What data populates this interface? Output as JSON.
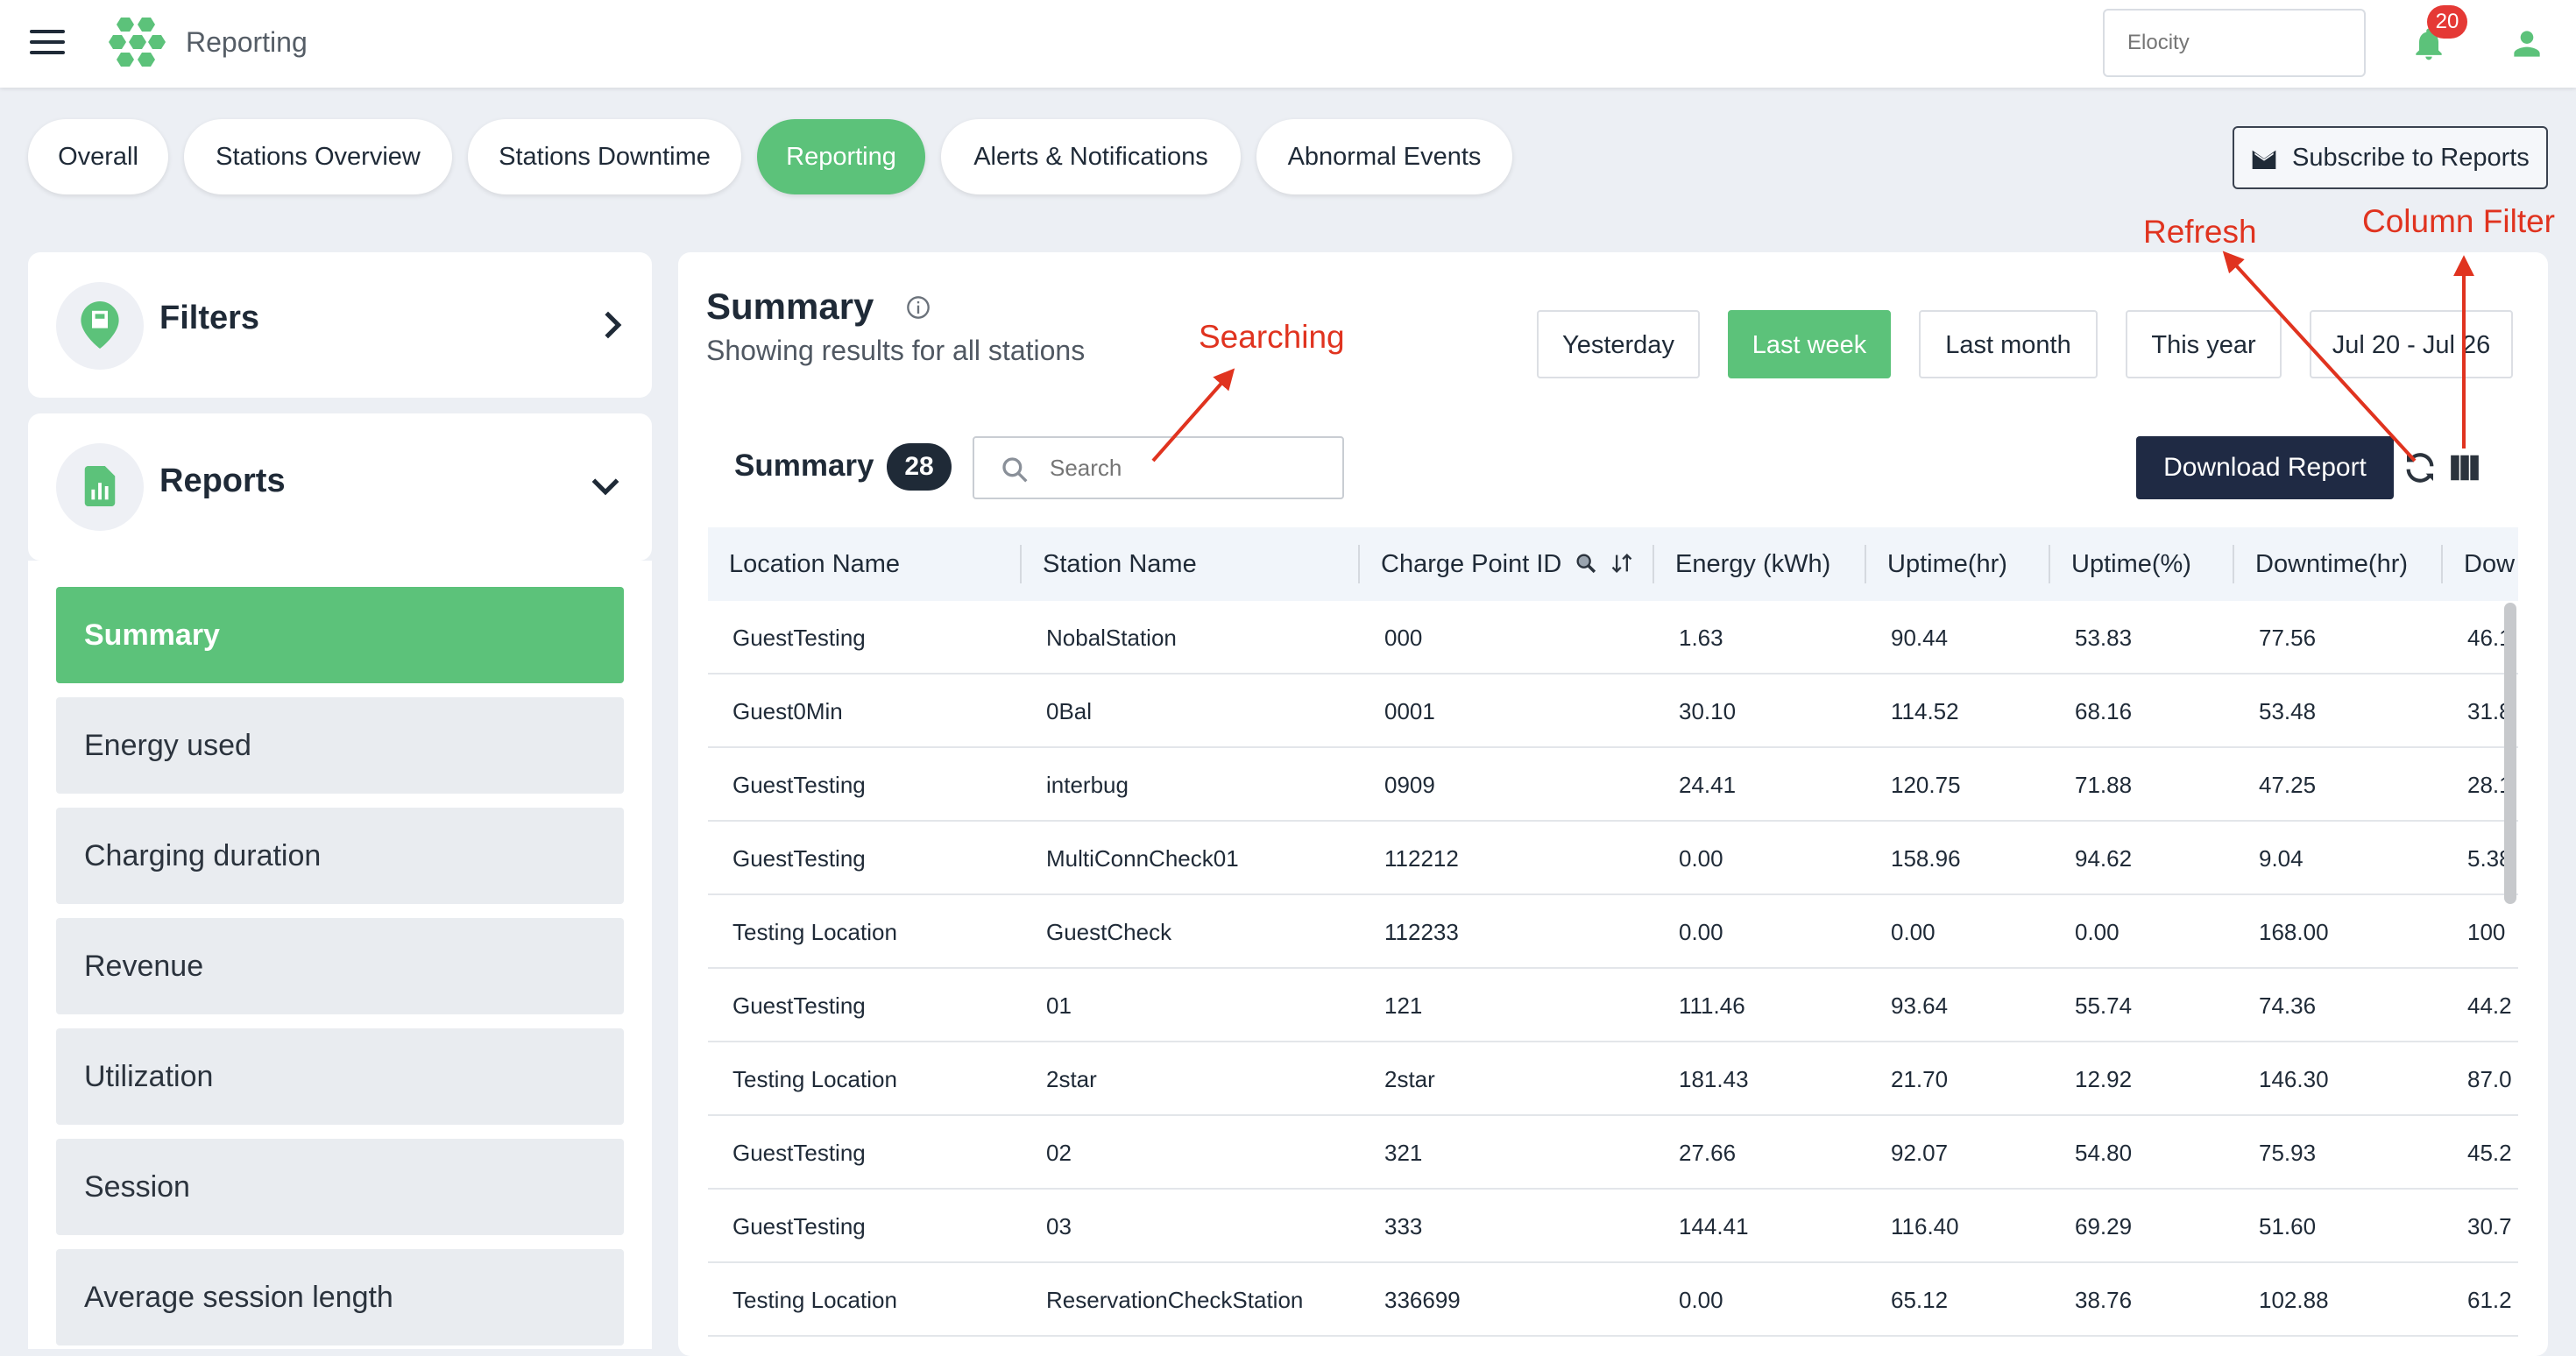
{
  "header": {
    "app_title": "Reporting",
    "org_placeholder": "Elocity",
    "notifications_count": "20"
  },
  "tabs": [
    {
      "label": "Overall"
    },
    {
      "label": "Stations Overview"
    },
    {
      "label": "Stations Downtime"
    },
    {
      "label": "Reporting"
    },
    {
      "label": "Alerts & Notifications"
    },
    {
      "label": "Abnormal Events"
    }
  ],
  "subscribe_label": "Subscribe to Reports",
  "sidebar": {
    "filters_label": "Filters",
    "reports_label": "Reports",
    "report_items": [
      {
        "label": "Summary"
      },
      {
        "label": "Energy used"
      },
      {
        "label": "Charging duration"
      },
      {
        "label": "Revenue"
      },
      {
        "label": "Utilization"
      },
      {
        "label": "Session"
      },
      {
        "label": "Average session length"
      }
    ]
  },
  "summary": {
    "title": "Summary",
    "subtitle": "Showing results for all stations",
    "ranges": [
      "Yesterday",
      "Last week",
      "Last month",
      "This year",
      "Jul 20 - Jul 26"
    ],
    "table_label": "Summary",
    "count": "28",
    "search_placeholder": "Search",
    "download_label": "Download Report"
  },
  "table": {
    "columns": [
      "Location Name",
      "Station Name",
      "Charge Point ID",
      "Energy (kWh)",
      "Uptime(hr)",
      "Uptime(%)",
      "Downtime(hr)",
      "Dow"
    ],
    "rows": [
      [
        "GuestTesting",
        "NobalStation",
        "000",
        "1.63",
        "90.44",
        "53.83",
        "77.56",
        "46.1"
      ],
      [
        "Guest0Min",
        "0Bal",
        "0001",
        "30.10",
        "114.52",
        "68.16",
        "53.48",
        "31.8"
      ],
      [
        "GuestTesting",
        "interbug",
        "0909",
        "24.41",
        "120.75",
        "71.88",
        "47.25",
        "28.1"
      ],
      [
        "GuestTesting",
        "MultiConnCheck01",
        "112212",
        "0.00",
        "158.96",
        "94.62",
        "9.04",
        "5.38"
      ],
      [
        "Testing Location",
        "GuestCheck",
        "112233",
        "0.00",
        "0.00",
        "0.00",
        "168.00",
        "100"
      ],
      [
        "GuestTesting",
        "01",
        "121",
        "111.46",
        "93.64",
        "55.74",
        "74.36",
        "44.2"
      ],
      [
        "Testing Location",
        "2star",
        "2star",
        "181.43",
        "21.70",
        "12.92",
        "146.30",
        "87.0"
      ],
      [
        "GuestTesting",
        "02",
        "321",
        "27.66",
        "92.07",
        "54.80",
        "75.93",
        "45.2"
      ],
      [
        "GuestTesting",
        "03",
        "333",
        "144.41",
        "116.40",
        "69.29",
        "51.60",
        "30.7"
      ],
      [
        "Testing Location",
        "ReservationCheckStation",
        "336699",
        "0.00",
        "65.12",
        "38.76",
        "102.88",
        "61.2"
      ]
    ]
  },
  "annotations": {
    "searching": "Searching",
    "refresh": "Refresh",
    "column_filter": "Column Filter"
  },
  "colors": {
    "accent_green": "#5cc27a",
    "dark_button": "#1f2a44",
    "annotation_red": "#e0331f",
    "badge_red": "#e53935"
  }
}
